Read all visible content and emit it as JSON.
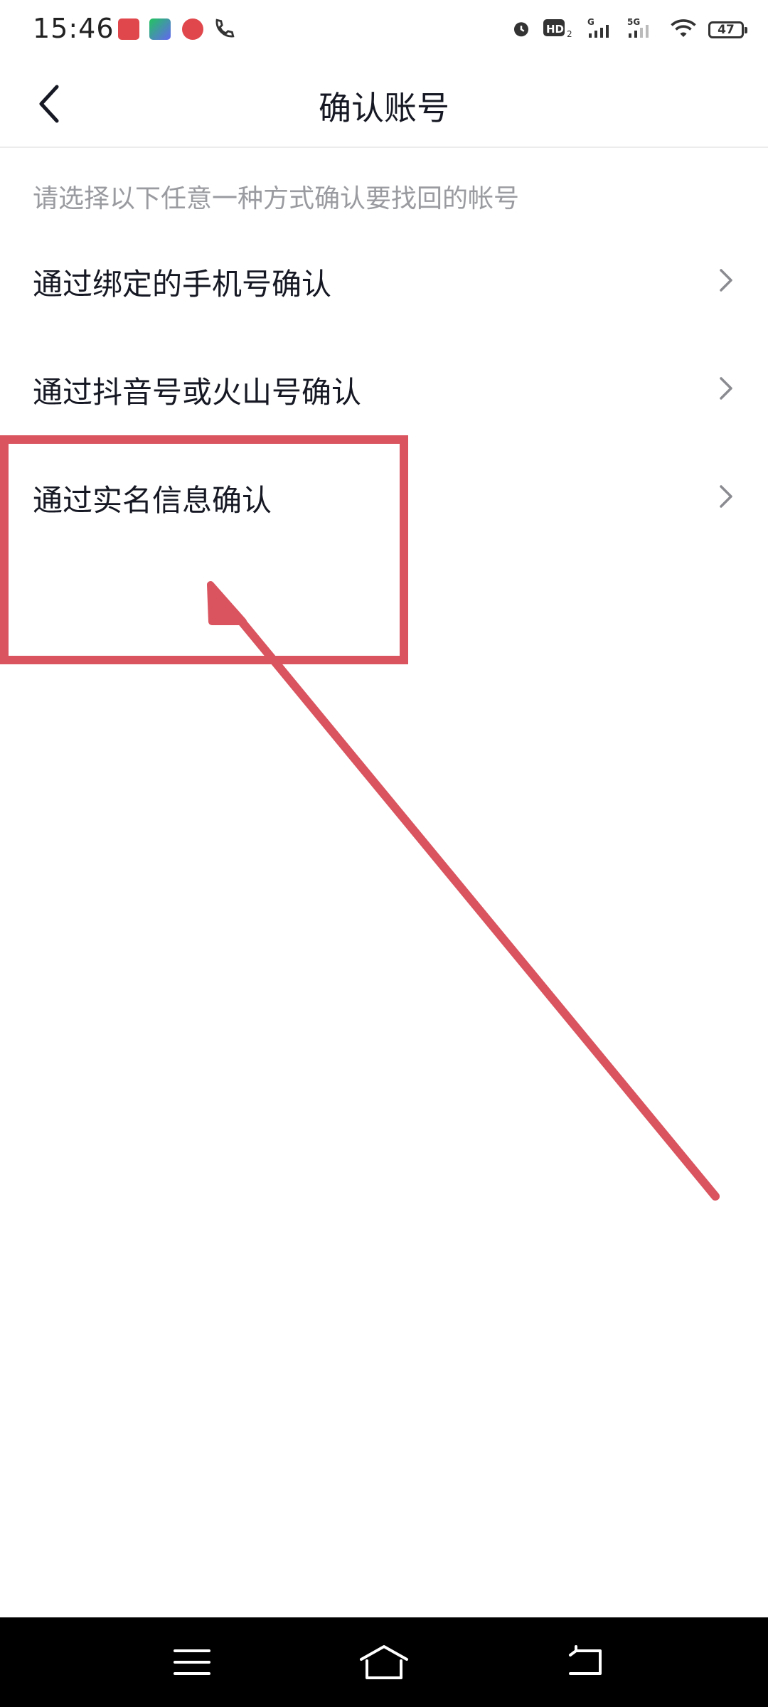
{
  "status_bar": {
    "time": "15:46",
    "battery": "47",
    "icons": [
      "huawei-app-icon",
      "iqiyi-app-icon",
      "video-app-icon",
      "phone-call-icon",
      "alarm-icon",
      "hd-icon",
      "signal-g-icon",
      "signal-5g-icon",
      "wifi-icon",
      "battery-icon"
    ]
  },
  "header": {
    "title": "确认账号",
    "back_icon": "chevron-left-icon"
  },
  "main": {
    "hint": "请选择以下任意一种方式确认要找回的帐号",
    "options": [
      {
        "label": "通过绑定的手机号确认",
        "icon": "chevron-right-icon"
      },
      {
        "label": "通过抖音号或火山号确认",
        "icon": "chevron-right-icon"
      },
      {
        "label": "通过实名信息确认",
        "icon": "chevron-right-icon"
      }
    ]
  },
  "annotation": {
    "color": "#d9545f"
  },
  "nav_bar": {
    "icons": [
      "menu-icon",
      "home-icon",
      "back-icon"
    ]
  }
}
